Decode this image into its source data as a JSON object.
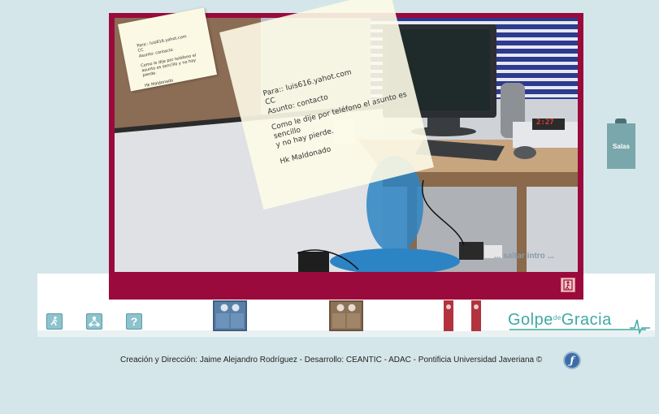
{
  "scene": {
    "note_small": {
      "lines": [
        "Para:: luis616.yahot.com",
        "CC",
        "Asunto: contacto",
        "Como le dije por teléfono el asunto es sencillo y no hay pierde.",
        "Hk Maldonado"
      ]
    },
    "note_big": {
      "to_line": "Para:: luis616.yahot.com",
      "cc_line": "CC",
      "subject_line": "Asunto: contacto",
      "body_line1": "Como le dije por teléfono el asunto es sencillo",
      "body_line2": "y no hay pierde.",
      "signature": "Hk Maldonado"
    },
    "clock": "2:27",
    "skip_intro": "... saltar intro ..."
  },
  "side_tab": {
    "label": "Salas"
  },
  "toolbar": {
    "exit_icon": "exit-runner-icon",
    "map_icon": "map-icon",
    "help_label": "?"
  },
  "brand": {
    "part1": "Golpe",
    "middle": "de",
    "part2": "Gracia"
  },
  "footer": {
    "credits": "Creación y Dirección: Jaime Alejandro Rodríguez - Desarrollo: CEANTIC - ADAC - Pontificia Universidad Javeriana ©"
  },
  "colors": {
    "stage_border": "#9b0a3c",
    "page_background": "#d4e6ea",
    "brand_teal": "#3fa9a3"
  }
}
